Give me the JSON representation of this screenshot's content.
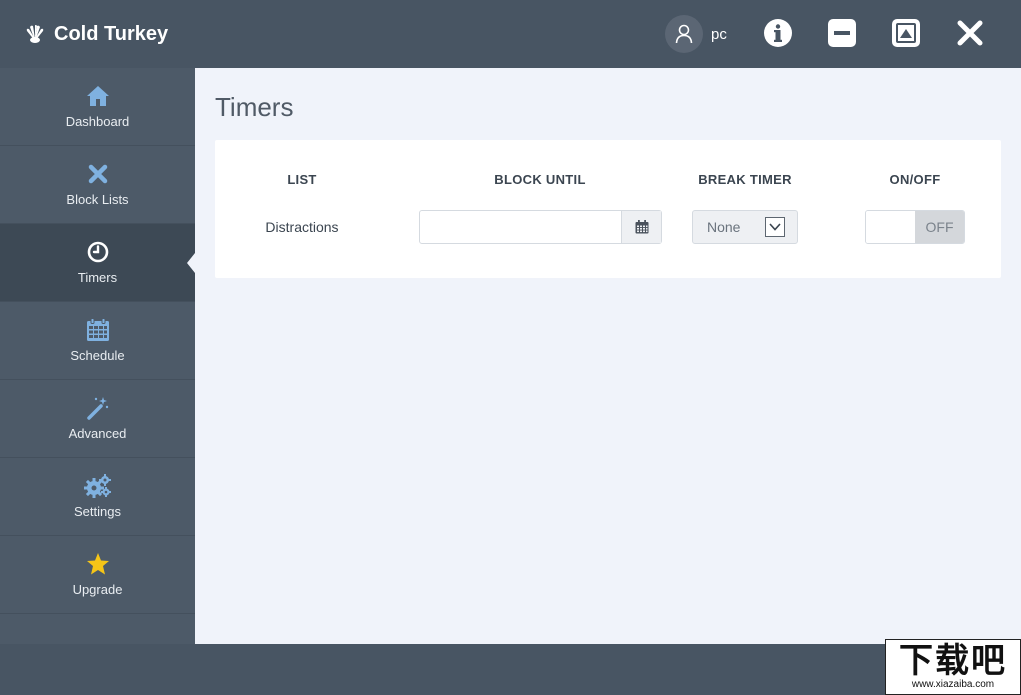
{
  "header": {
    "app_title": "Cold Turkey",
    "user_name": "pc",
    "icons": {
      "logo": "turkey-fan-icon",
      "user": "user-icon",
      "info": "info-icon",
      "minimize": "minimize-icon",
      "maximize": "maximize-icon",
      "close": "close-icon"
    }
  },
  "sidebar": {
    "items": [
      {
        "label": "Dashboard",
        "icon": "home-icon"
      },
      {
        "label": "Block Lists",
        "icon": "x-icon"
      },
      {
        "label": "Timers",
        "icon": "clock-icon",
        "active": true
      },
      {
        "label": "Schedule",
        "icon": "calendar-icon"
      },
      {
        "label": "Advanced",
        "icon": "magic-wand-icon"
      },
      {
        "label": "Settings",
        "icon": "gears-icon"
      },
      {
        "label": "Upgrade",
        "icon": "star-icon"
      }
    ]
  },
  "main": {
    "page_title": "Timers",
    "table": {
      "columns": [
        "LIST",
        "BLOCK UNTIL",
        "BREAK TIMER",
        "ON/OFF"
      ],
      "rows": [
        {
          "list": "Distractions",
          "block_until": "",
          "break_timer": "None",
          "toggle": "OFF"
        }
      ]
    }
  },
  "watermark": {
    "text": "下载吧",
    "url": "www.xiazaiba.com"
  },
  "colors": {
    "header_bg": "#485563",
    "sidebar_bg": "#4d5a68",
    "sidebar_active_bg": "#3d4955",
    "icon_blue": "#7fb1e0",
    "star_yellow": "#f5c518",
    "main_bg": "#f0f3fa"
  }
}
